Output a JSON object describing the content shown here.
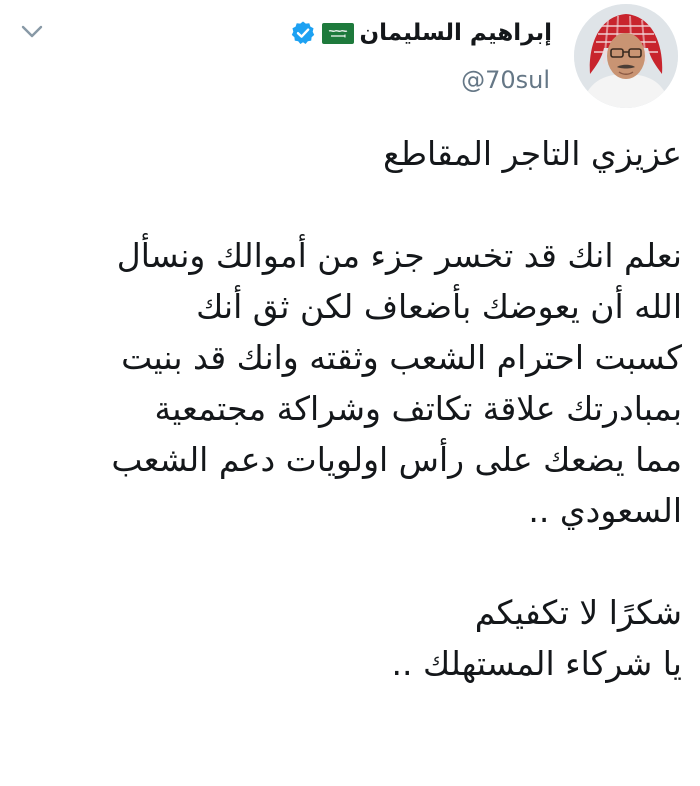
{
  "tweet": {
    "display_name": "إبراهيم السليمان",
    "handle": "@70sul",
    "verified": true,
    "flag_text": "سعودي",
    "colors": {
      "verified": "#1da1f2",
      "handle": "#657786",
      "text": "#14171a",
      "flag": "#1e7a3c"
    },
    "body": {
      "greeting": "عزيزي التاجر المقاطع",
      "para1": [
        "نعلم انك قد تخسر جزء من أموالك ونسأل",
        "الله أن يعوضك بأضعاف لكن ثق أنك",
        "كسبت احترام الشعب وثقته وانك قد بنيت",
        "بمبادرتك علاقة تكاتف وشراكة مجتمعية",
        "مما يضعك على رأس اولويات دعم الشعب",
        "السعودي .."
      ],
      "para2": [
        "شكرًا لا تكفيكم",
        "يا شركاء المستهلك .."
      ]
    }
  }
}
